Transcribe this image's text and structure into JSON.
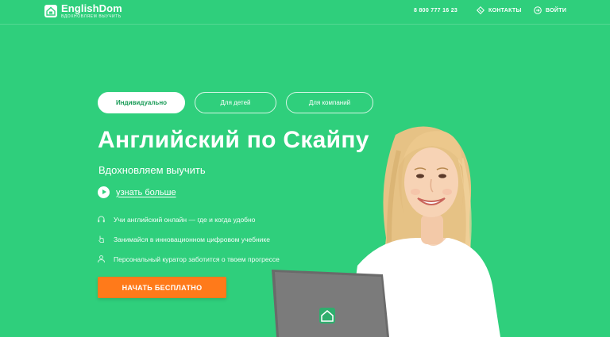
{
  "colors": {
    "background": "#2fcf7c",
    "accent_orange": "#ff7a1a",
    "active_tab_text": "#179a55",
    "white": "#ffffff"
  },
  "header": {
    "logo_name": "EnglishDom",
    "logo_tagline": "ВДОХНОВЛЯЕМ ВЫУЧИТЬ",
    "phone": "8 800 777 16 23",
    "contacts_label": "КОНТАКТЫ",
    "contacts_icon": "phone-icon",
    "login_label": "ВОЙТИ",
    "login_icon": "login-icon"
  },
  "tabs": [
    {
      "label": "Индивидуально",
      "active": true
    },
    {
      "label": "Для детей",
      "active": false
    },
    {
      "label": "Для компаний",
      "active": false
    }
  ],
  "hero": {
    "title": "Английский по Скайпу",
    "subtitle": "Вдохновляем выучить",
    "learn_more": "узнать больше",
    "features": [
      {
        "icon": "headset-icon",
        "text": "Учи английский онлайн — где и когда удобно"
      },
      {
        "icon": "hand-pointer-icon",
        "text": "Занимайся в инновационном цифровом учебнике"
      },
      {
        "icon": "curator-icon",
        "text": "Персональный куратор заботится о твоем прогрессе"
      }
    ],
    "cta": "НАЧАТЬ БЕСПЛАТНО",
    "image_subject": "smiling-woman-with-laptop"
  }
}
